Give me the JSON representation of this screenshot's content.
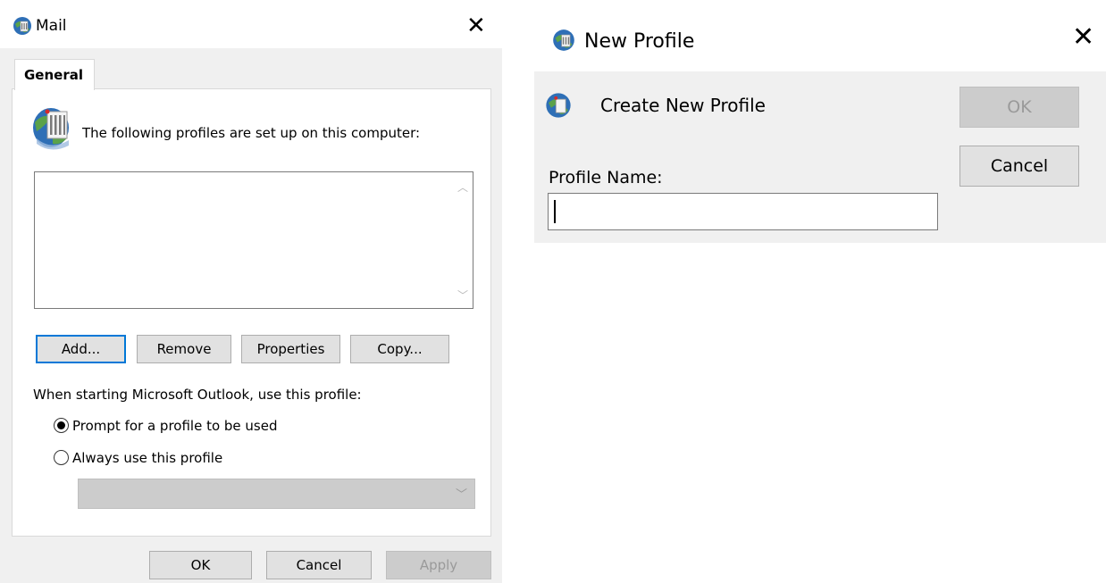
{
  "mail_dialog": {
    "title": "Mail",
    "close_symbol": "✕",
    "tab": "General",
    "intro": "The following profiles are set up on this computer:",
    "profiles": [],
    "buttons": {
      "add": "Add...",
      "remove": "Remove",
      "properties": "Properties",
      "copy": "Copy..."
    },
    "startup_label": "When starting Microsoft Outlook, use this profile:",
    "radio_options": [
      {
        "label": "Prompt for a profile to be used",
        "checked": true
      },
      {
        "label": "Always use this profile",
        "checked": false
      }
    ],
    "selected_profile": "",
    "footer": {
      "ok": "OK",
      "cancel": "Cancel",
      "apply": "Apply"
    }
  },
  "new_profile_dialog": {
    "title": "New Profile",
    "close_symbol": "✕",
    "heading": "Create New Profile",
    "field_label": "Profile Name:",
    "field_value": "",
    "buttons": {
      "ok": "OK",
      "cancel": "Cancel"
    }
  },
  "colors": {
    "dialog_bg": "#f0f0f0",
    "focus_border": "#0078d7",
    "disabled_bg": "#cccccc",
    "button_bg": "#e1e1e1"
  },
  "icons": {
    "mail_title": "mail-globe-icon",
    "profiles": "profiles-server-icon",
    "new_profile": "mail-globe-icon"
  }
}
